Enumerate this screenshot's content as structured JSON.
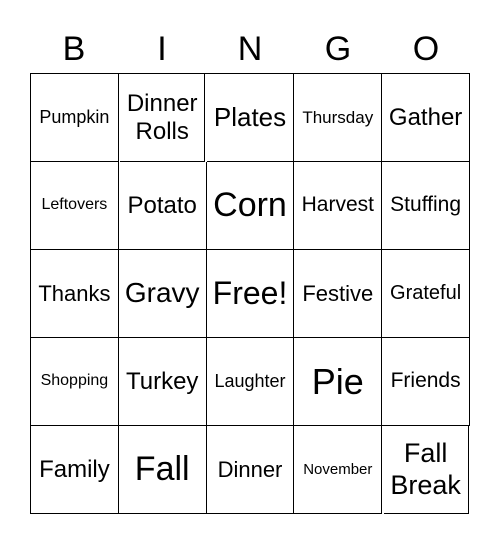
{
  "header": [
    "B",
    "I",
    "N",
    "G",
    "O"
  ],
  "cells": [
    "Pumpkin",
    "Dinner Rolls",
    "Plates",
    "Thursday",
    "Gather",
    "Leftovers",
    "Potato",
    "Corn",
    "Harvest",
    "Stuffing",
    "Thanks",
    "Gravy",
    "Free!",
    "Festive",
    "Grateful",
    "Shopping",
    "Turkey",
    "Laughter",
    "Pie",
    "Friends",
    "Family",
    "Fall",
    "Dinner",
    "November",
    "Fall Break"
  ]
}
